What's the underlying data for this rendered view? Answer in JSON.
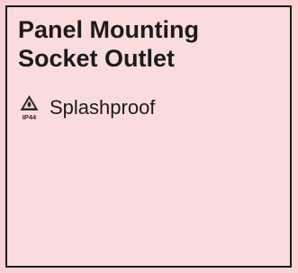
{
  "card": {
    "title_line1": "Panel Mounting",
    "title_line2": "Socket Outlet",
    "features": [
      {
        "icon": "splashproof-ip44-icon",
        "label": "Splashproof",
        "icon_text": "IP44"
      }
    ]
  },
  "colors": {
    "background": "#f9d2d2",
    "card_background": "#fbdcdc",
    "border": "#1a1a1a",
    "text": "#1b1b1b"
  }
}
